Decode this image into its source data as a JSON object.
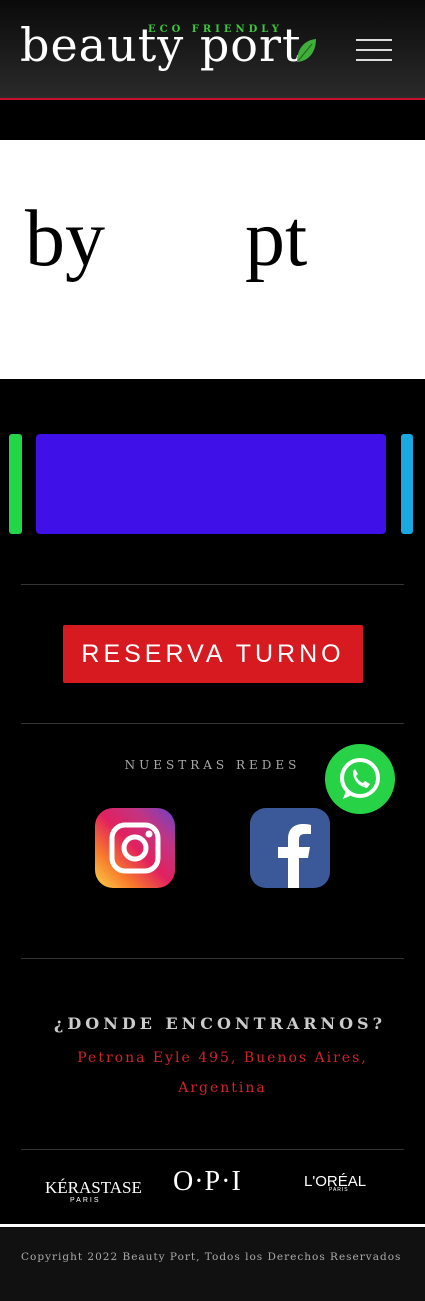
{
  "header": {
    "eco_label": "ECO FRIENDLY",
    "logo_text": "beauty port",
    "menu_icon": "hamburger-menu-icon"
  },
  "banner": {
    "left_text": "by",
    "right_text": "pt"
  },
  "slider": {
    "colors": {
      "left": "#22d648",
      "main": "#4010e8",
      "right": "#1aa8e0"
    }
  },
  "cta": {
    "label": "RESERVA TURNO",
    "color": "#d61a1f"
  },
  "social": {
    "title": "NUESTRAS REDES",
    "whatsapp_icon": "whatsapp-icon",
    "instagram_icon": "instagram-icon",
    "facebook_icon": "facebook-icon"
  },
  "location": {
    "title": "¿DONDE ENCONTRARNOS?",
    "address_line1": "Petrona Eyle 495, Buenos Aires,",
    "address_line2": "Argentina"
  },
  "brands": {
    "kerastase": "KÉRASTASE",
    "kerastase_sub": "PARIS",
    "opi": "O·P·I",
    "loreal": "L'ORÉAL",
    "loreal_sub": "PARIS"
  },
  "footer": {
    "copyright": "Copyright 2022 Beauty Port, Todos los Derechos Reservados"
  }
}
